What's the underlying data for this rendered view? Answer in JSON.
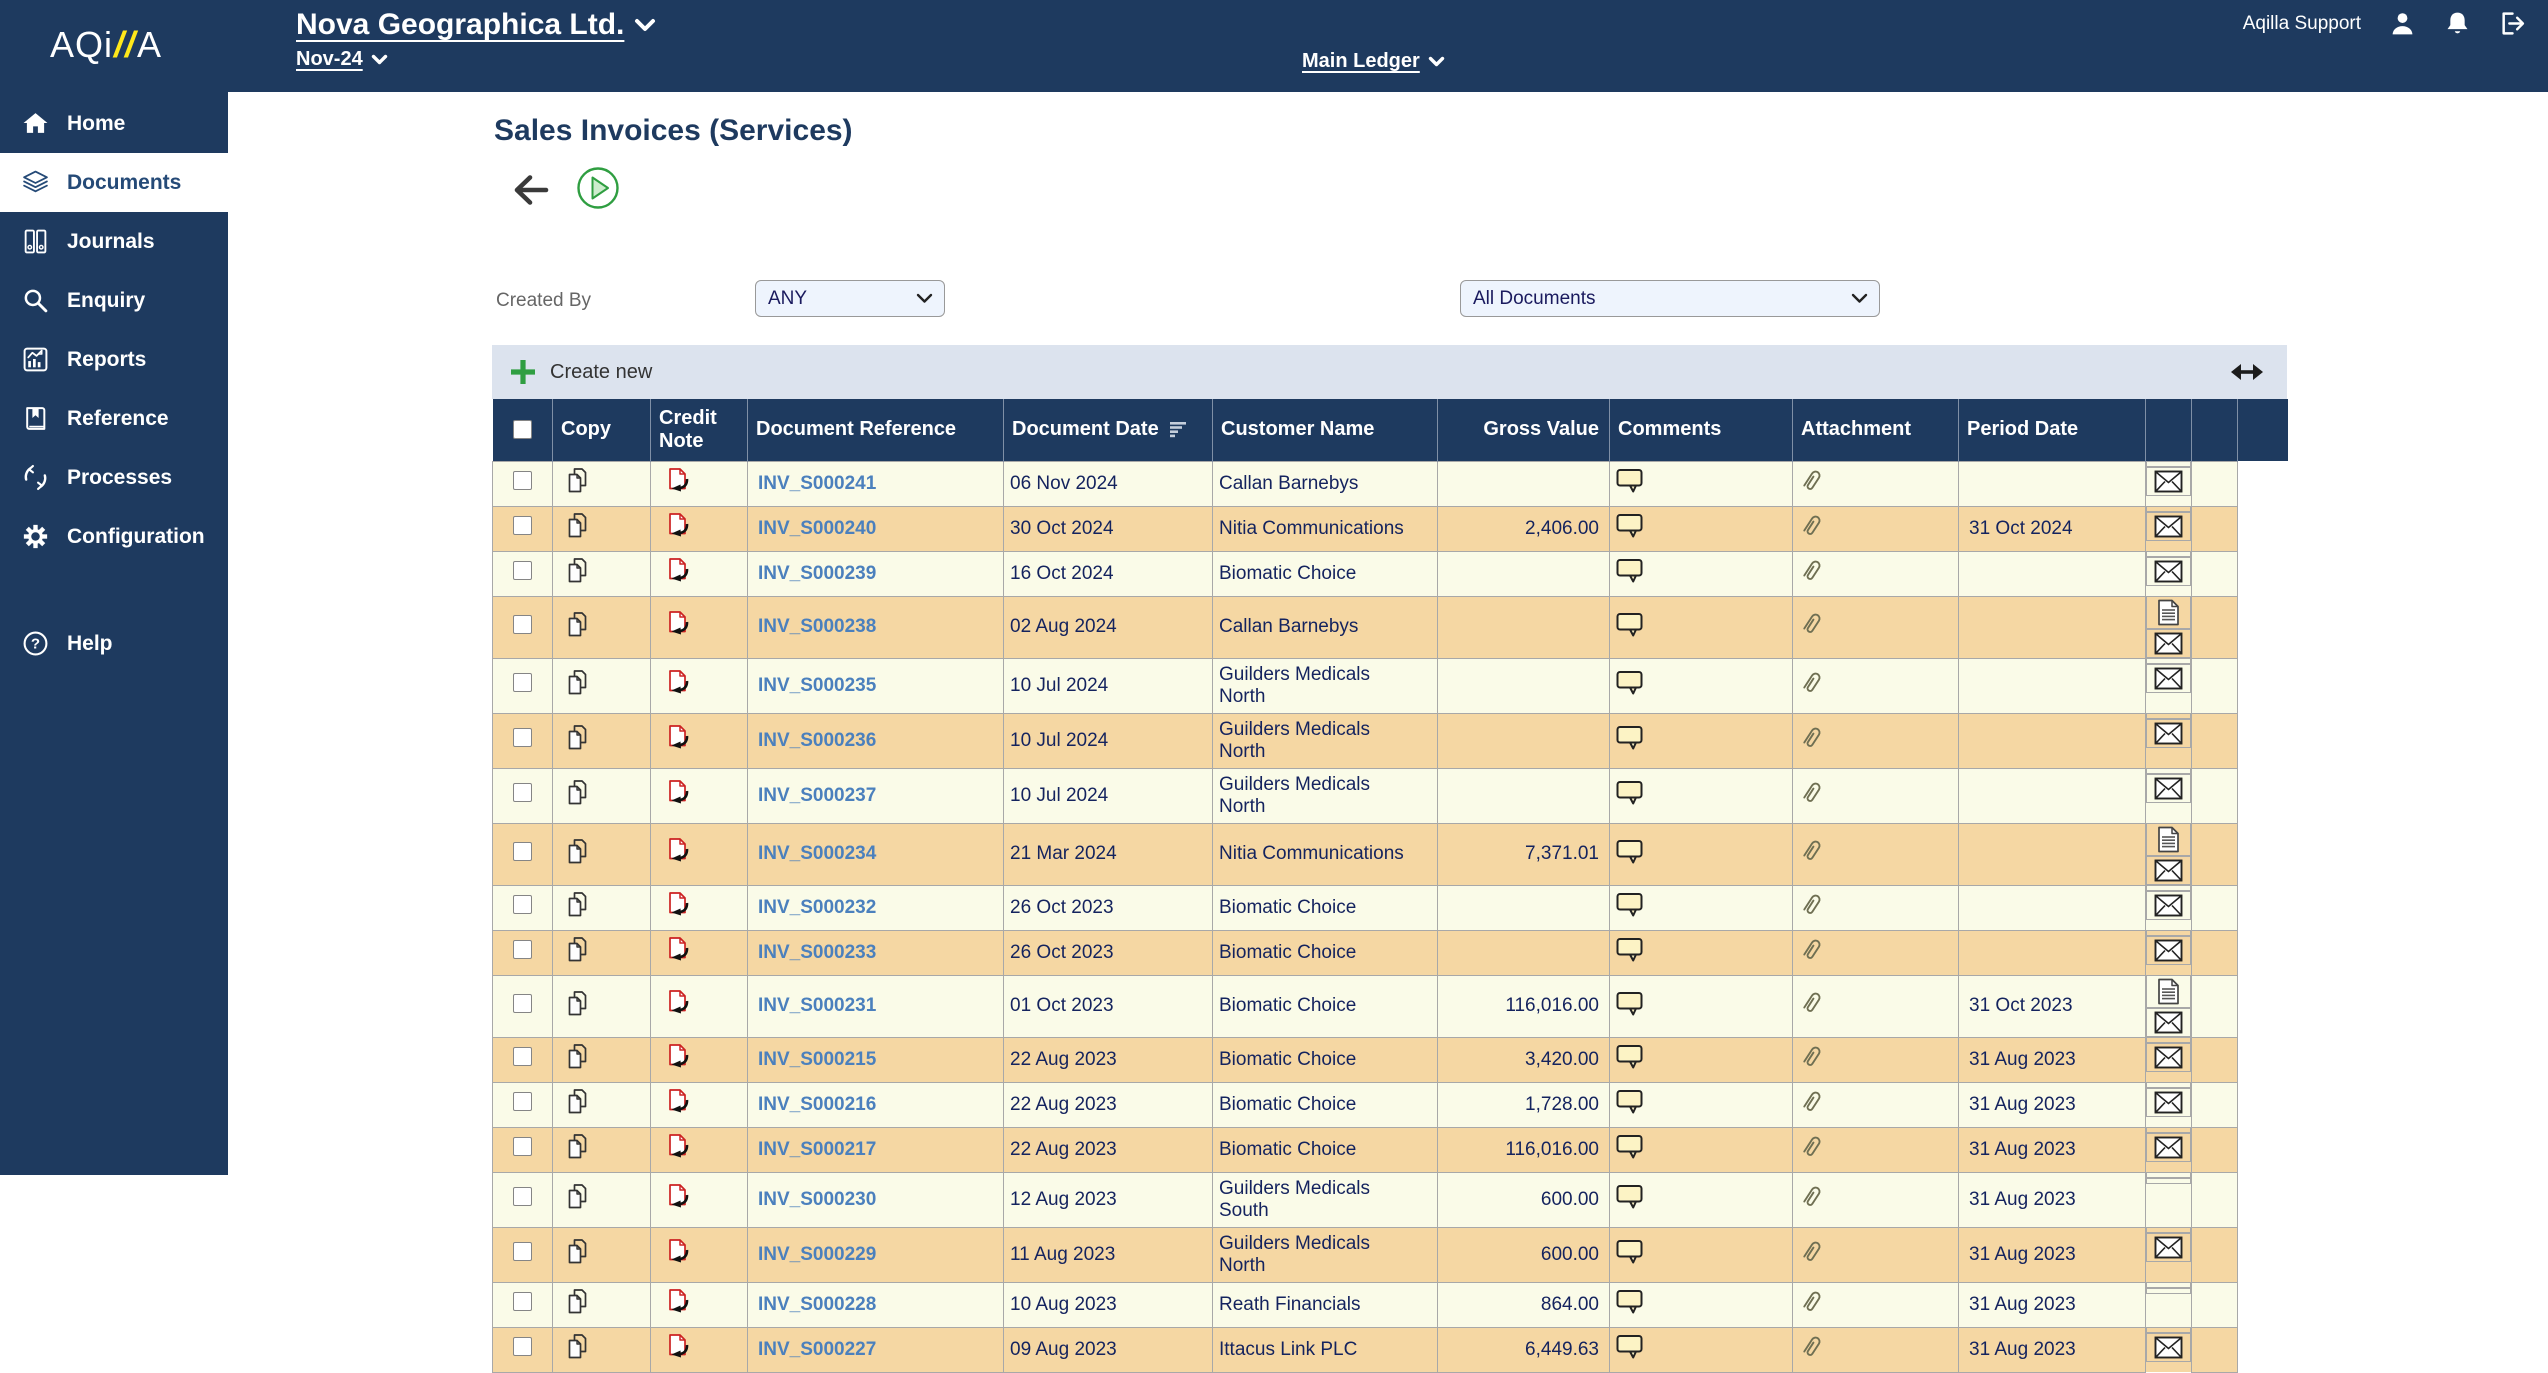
{
  "colors": {
    "navy": "#1e3a5f",
    "ink": "#14235e",
    "link": "#4b80bd",
    "green": "#2f9e41",
    "tan": "#f5d7a3",
    "cream": "#fafbe8",
    "toolbar": "#dce3ee",
    "yellow": "#ffe81a",
    "red": "#cc2222"
  },
  "topbar": {
    "logo_pre": "AQi",
    "logo_slashes": "//",
    "logo_post": "A",
    "company": "Nova Geographica Ltd.",
    "period": "Nov-24",
    "ledger": "Main Ledger",
    "support_user": "Aqilla Support",
    "icons": [
      "person-icon",
      "bell-icon",
      "logout-icon"
    ]
  },
  "sidebar": {
    "items": [
      {
        "label": "Home",
        "icon": "home-icon",
        "active": false
      },
      {
        "label": "Documents",
        "icon": "documents-icon",
        "active": true
      },
      {
        "label": "Journals",
        "icon": "journals-icon",
        "active": false
      },
      {
        "label": "Enquiry",
        "icon": "enquiry-icon",
        "active": false
      },
      {
        "label": "Reports",
        "icon": "reports-icon",
        "active": false
      },
      {
        "label": "Reference",
        "icon": "reference-icon",
        "active": false
      },
      {
        "label": "Processes",
        "icon": "processes-icon",
        "active": false
      },
      {
        "label": "Configuration",
        "icon": "configuration-icon",
        "active": false
      },
      {
        "label": "Help",
        "icon": "help-icon",
        "active": false
      }
    ]
  },
  "page": {
    "title": "Sales Invoices (Services)",
    "created_by_label": "Created By",
    "created_by_value": "ANY",
    "document_filter_value": "All Documents",
    "create_new_label": "Create new"
  },
  "table": {
    "columns": [
      {
        "key": "select",
        "label": ""
      },
      {
        "key": "copy",
        "label": "Copy"
      },
      {
        "key": "credit_note",
        "label": "Credit Note"
      },
      {
        "key": "document_reference",
        "label": "Document Reference"
      },
      {
        "key": "document_date",
        "label": "Document Date",
        "sort": true
      },
      {
        "key": "customer_name",
        "label": "Customer Name"
      },
      {
        "key": "gross_value",
        "label": "Gross Value"
      },
      {
        "key": "comments",
        "label": "Comments"
      },
      {
        "key": "attachment",
        "label": "Attachment"
      },
      {
        "key": "period_date",
        "label": "Period Date"
      },
      {
        "key": "notes",
        "label": ""
      },
      {
        "key": "mail",
        "label": ""
      },
      {
        "key": "spacer",
        "label": ""
      }
    ],
    "row_icons": {
      "copy": "copy-icon",
      "credit_note": "credit-note-icon",
      "comments": "comment-icon",
      "attachment": "paperclip-icon",
      "notes": "document-note-icon",
      "mail": "envelope-icon"
    },
    "rows": [
      {
        "ref": "INV_S000241",
        "date": "06 Nov 2024",
        "customer": "Callan Barnebys",
        "gross": "",
        "period": "",
        "note": false,
        "mail": true
      },
      {
        "ref": "INV_S000240",
        "date": "30 Oct 2024",
        "customer": "Nitia Communications",
        "gross": "2,406.00",
        "period": "31 Oct 2024",
        "note": false,
        "mail": true
      },
      {
        "ref": "INV_S000239",
        "date": "16 Oct 2024",
        "customer": "Biomatic Choice",
        "gross": "",
        "period": "",
        "note": false,
        "mail": true
      },
      {
        "ref": "INV_S000238",
        "date": "02 Aug 2024",
        "customer": "Callan Barnebys",
        "gross": "",
        "period": "",
        "note": true,
        "mail": true
      },
      {
        "ref": "INV_S000235",
        "date": "10 Jul 2024",
        "customer": "Guilders Medicals North",
        "gross": "",
        "period": "",
        "note": false,
        "mail": true
      },
      {
        "ref": "INV_S000236",
        "date": "10 Jul 2024",
        "customer": "Guilders Medicals North",
        "gross": "",
        "period": "",
        "note": false,
        "mail": true
      },
      {
        "ref": "INV_S000237",
        "date": "10 Jul 2024",
        "customer": "Guilders Medicals North",
        "gross": "",
        "period": "",
        "note": false,
        "mail": true
      },
      {
        "ref": "INV_S000234",
        "date": "21 Mar 2024",
        "customer": "Nitia Communications",
        "gross": "7,371.01",
        "period": "",
        "note": true,
        "mail": true
      },
      {
        "ref": "INV_S000232",
        "date": "26 Oct 2023",
        "customer": "Biomatic Choice",
        "gross": "",
        "period": "",
        "note": false,
        "mail": true
      },
      {
        "ref": "INV_S000233",
        "date": "26 Oct 2023",
        "customer": "Biomatic Choice",
        "gross": "",
        "period": "",
        "note": false,
        "mail": true
      },
      {
        "ref": "INV_S000231",
        "date": "01 Oct 2023",
        "customer": "Biomatic Choice",
        "gross": "116,016.00",
        "period": "31 Oct 2023",
        "note": true,
        "mail": true
      },
      {
        "ref": "INV_S000215",
        "date": "22 Aug 2023",
        "customer": "Biomatic Choice",
        "gross": "3,420.00",
        "period": "31 Aug 2023",
        "note": false,
        "mail": true
      },
      {
        "ref": "INV_S000216",
        "date": "22 Aug 2023",
        "customer": "Biomatic Choice",
        "gross": "1,728.00",
        "period": "31 Aug 2023",
        "note": false,
        "mail": true
      },
      {
        "ref": "INV_S000217",
        "date": "22 Aug 2023",
        "customer": "Biomatic Choice",
        "gross": "116,016.00",
        "period": "31 Aug 2023",
        "note": false,
        "mail": true
      },
      {
        "ref": "INV_S000230",
        "date": "12 Aug 2023",
        "customer": "Guilders Medicals South",
        "gross": "600.00",
        "period": "31 Aug 2023",
        "note": false,
        "mail": false
      },
      {
        "ref": "INV_S000229",
        "date": "11 Aug 2023",
        "customer": "Guilders Medicals North",
        "gross": "600.00",
        "period": "31 Aug 2023",
        "note": false,
        "mail": true
      },
      {
        "ref": "INV_S000228",
        "date": "10 Aug 2023",
        "customer": "Reath Financials",
        "gross": "864.00",
        "period": "31 Aug 2023",
        "note": false,
        "mail": false
      },
      {
        "ref": "INV_S000227",
        "date": "09 Aug 2023",
        "customer": "Ittacus Link PLC",
        "gross": "6,449.63",
        "period": "31 Aug 2023",
        "note": false,
        "mail": true
      }
    ]
  }
}
